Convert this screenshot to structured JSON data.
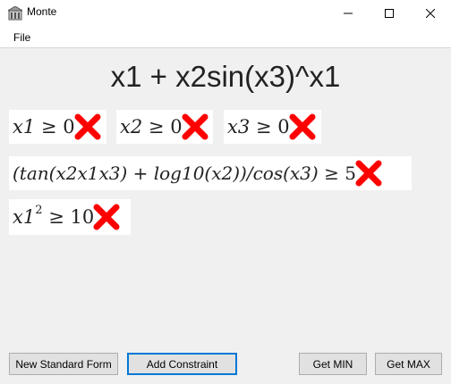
{
  "window": {
    "title": "Monte",
    "app_icon": "building-icon",
    "controls": [
      "minimize-icon",
      "maximize-icon",
      "close-icon"
    ]
  },
  "menu": {
    "items": [
      "File"
    ]
  },
  "objective": {
    "expression": "x1 + x2sin(x3)^x1"
  },
  "constraints": [
    {
      "lhs": "x1",
      "op": "≥",
      "rhs": "0",
      "status_icon": "red-x-icon"
    },
    {
      "lhs": "x2",
      "op": "≥",
      "rhs": "0",
      "status_icon": "red-x-icon"
    },
    {
      "lhs": "x3",
      "op": "≥",
      "rhs": "0",
      "status_icon": "red-x-icon"
    },
    {
      "lhs": "(tan(x2x1x3) + log10(x2))/cos(x3)",
      "op": "≥",
      "rhs": "5",
      "status_icon": "red-x-icon"
    },
    {
      "lhs": "x1",
      "exponent": "2",
      "op": "≥",
      "rhs": "10",
      "status_icon": "red-x-icon"
    }
  ],
  "buttons": {
    "new_standard_form": "New Standard Form",
    "add_constraint": "Add Constraint",
    "get_min": "Get MIN",
    "get_max": "Get MAX"
  },
  "colors": {
    "x_mark": "#ff0000",
    "focus_border": "#0078d7"
  }
}
